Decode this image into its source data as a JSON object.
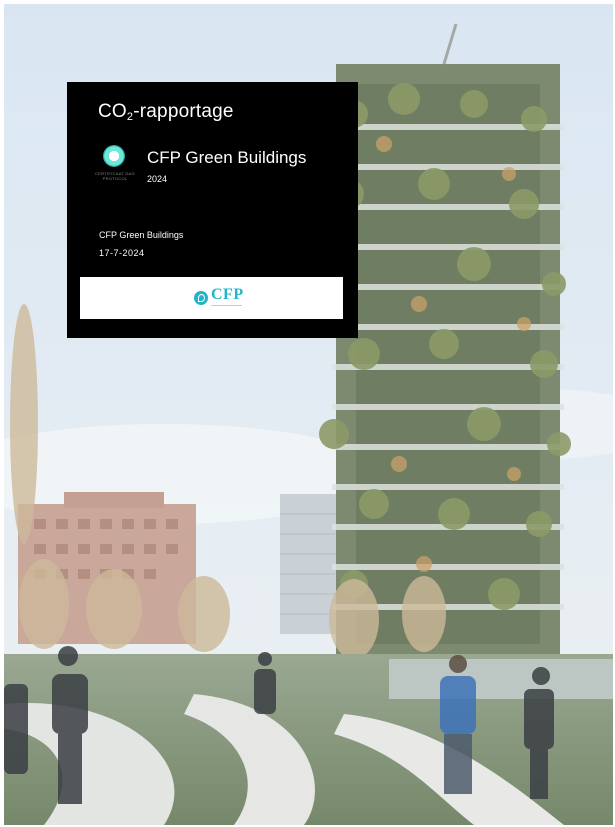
{
  "cover": {
    "title_prefix": "CO",
    "title_subscript": "2",
    "title_suffix": "-rapportage",
    "company_heading": "CFP Green Buildings",
    "year": "2024",
    "company_name": "CFP Green Buildings",
    "date": "17-7-2024",
    "seal_caption": "CERTIFICAAT DAG PROTOCOL",
    "brand_logo_text": "CFP"
  },
  "background_photo": {
    "subject": "vertical-forest-tower",
    "icon": "photo-icon"
  },
  "colors": {
    "card_background": "#000000",
    "card_text": "#ffffff",
    "brand_accent": "#23b4c8",
    "seal_accent": "#6fe6d8"
  }
}
